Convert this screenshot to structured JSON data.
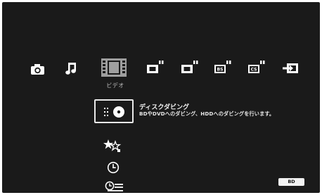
{
  "categories": [
    {
      "name": "photo",
      "icon": "camera-icon"
    },
    {
      "name": "music",
      "icon": "music-note-icon"
    },
    {
      "name": "video",
      "icon": "film-icon",
      "label": "ビデオ",
      "selected": true
    },
    {
      "name": "tv-1",
      "icon": "tv-icon"
    },
    {
      "name": "tv-2",
      "icon": "tv-icon"
    },
    {
      "name": "bs",
      "icon": "bs-tv-icon",
      "badge": "BS"
    },
    {
      "name": "cs",
      "icon": "cs-tv-icon",
      "badge": "CS"
    },
    {
      "name": "input",
      "icon": "input-icon"
    }
  ],
  "menu": {
    "selected": {
      "icon": "disc-dubbing-icon",
      "title": "ディスクダビング",
      "description": "BDやDVDへのダビング、HDDへのダビングを行います。"
    },
    "items": [
      {
        "icon": "favorites-stars-icon"
      },
      {
        "icon": "timer-icon"
      },
      {
        "icon": "schedule-list-icon"
      }
    ]
  },
  "badge": "BD",
  "colors": {
    "background": "#1a1a1a",
    "icon": "#ffffff",
    "selected_category": "#9e9e9e",
    "text": "#f2f2f2"
  }
}
